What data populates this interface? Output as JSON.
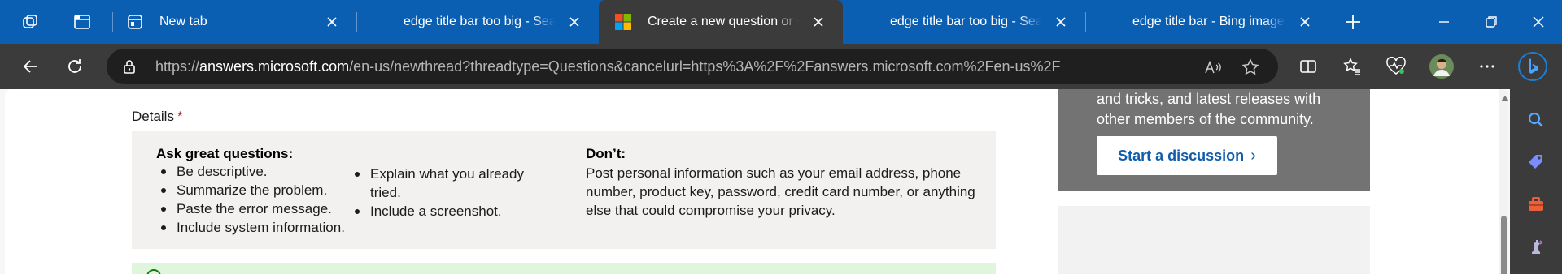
{
  "tabstrip": {
    "tabs": [
      {
        "title": "New tab",
        "icon": "new-tab-icon",
        "active": false
      },
      {
        "title": "edge title bar too big - Search",
        "icon": "bing-icon",
        "active": false
      },
      {
        "title": "Create a new question or start a discussion",
        "icon": "microsoft-logo-icon",
        "active": true
      },
      {
        "title": "edge title bar too big - Search",
        "icon": "bing-icon",
        "active": false
      },
      {
        "title": "edge title bar - Bing images",
        "icon": "bing-icon",
        "active": false
      }
    ]
  },
  "address_bar": {
    "url_scheme": "https://",
    "url_host": "answers.microsoft.com",
    "url_path": "/en-us/newthread?threadtype=Questions&cancelurl=https%3A%2F%2Fanswers.microsoft.com%2Fen-us%2F"
  },
  "form": {
    "details_label": "Details",
    "required_marker": "*"
  },
  "tips": {
    "ask_heading": "Ask great questions:",
    "ask_col1": [
      "Be descriptive.",
      "Summarize the problem.",
      "Paste the error message.",
      "Include system information."
    ],
    "ask_col2": [
      "Explain what you already tried.",
      "Include a screenshot."
    ],
    "dont_heading": "Don’t:",
    "dont_text": "Post personal information such as your email address, phone number, product key, password, credit card number, or anything else that could compromise your privacy."
  },
  "promo": {
    "text": "and tricks, and latest releases with other members of the community.",
    "button_label": "Start a discussion",
    "button_chevron": "›"
  },
  "colors": {
    "tabstrip_bg": "#0b5fb3",
    "toolbar_bg": "#3b3b3b",
    "promo_bg": "#737373",
    "button_text": "#0f5dab",
    "required": "#a4262c"
  }
}
